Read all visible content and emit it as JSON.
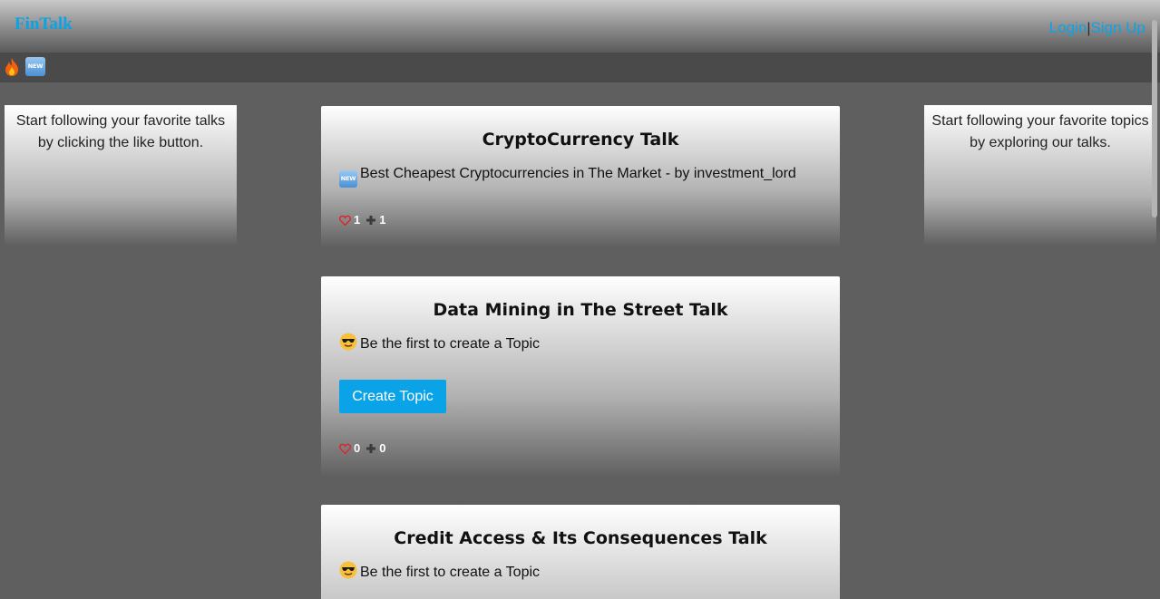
{
  "header": {
    "brand": "FinTalk",
    "login_label": "Login",
    "separator": "|",
    "signup_label": "Sign Up"
  },
  "subbar": {
    "icons": [
      "fire-icon",
      "new-badge-icon"
    ],
    "new_badge_text": "NEW"
  },
  "left_panel": {
    "text": "Start following your favorite talks by clicking the like button."
  },
  "right_panel": {
    "text": "Start following your favorite topics by exploring our talks."
  },
  "cards": [
    {
      "title": "CryptoCurrency Talk",
      "line_icon": "new-badge-icon",
      "line_text": "Best Cheapest Cryptocurrencies in The Market - by investment_lord",
      "likes": "1",
      "follows": "1"
    },
    {
      "title": "Data Mining in The Street Talk",
      "line_icon": "sunglasses-face-icon",
      "line_text": "Be the first to create a Topic",
      "button_label": "Create Topic",
      "likes": "0",
      "follows": "0"
    },
    {
      "title": "Credit Access & Its Consequences Talk",
      "line_icon": "sunglasses-face-icon",
      "line_text": "Be the first to create a Topic"
    }
  ],
  "colors": {
    "accent": "#0aa3e8",
    "background": "#5f5f5f",
    "subbar": "#4a4a4a",
    "heart": "#e0242c"
  }
}
